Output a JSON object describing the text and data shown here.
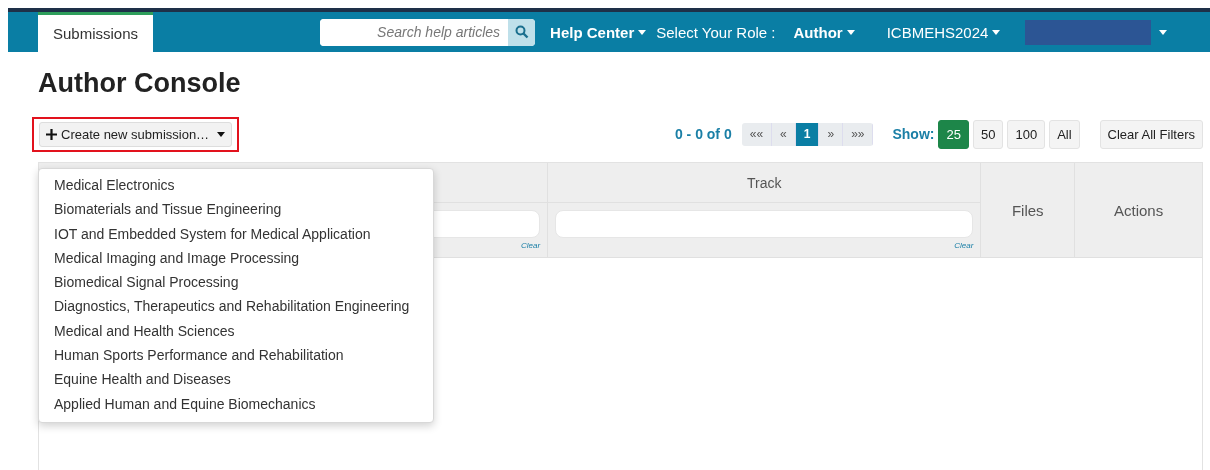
{
  "navbar": {
    "tabs": [
      {
        "label": "Submissions",
        "selected": true
      }
    ],
    "search": {
      "placeholder": "Search help articles"
    },
    "help_menu": "Help Center",
    "role_label": "Select Your Role :",
    "role": "Author",
    "conference": "ICBMEHS2024",
    "user_redacted": true
  },
  "title": "Author Console",
  "create_button": {
    "label": "Create new submission…",
    "expanded": true,
    "highlighted": true
  },
  "dropdown": [
    {
      "label": "Medical Electronics"
    },
    {
      "label": "Biomaterials and Tissue Engineering"
    },
    {
      "label": "IOT and Embedded System for Medical Application"
    },
    {
      "label": "Medical Imaging and Image Processing"
    },
    {
      "label": "Biomedical Signal Processing"
    },
    {
      "label": "Diagnostics, Therapeutics and Rehabilitation Engineering"
    },
    {
      "label": "Medical and Health Sciences"
    },
    {
      "label": "Human Sports Performance and Rehabilitation"
    },
    {
      "label": "Equine Health and Diseases"
    },
    {
      "label": "Applied Human and Equine Biomechanics"
    }
  ],
  "pagination": {
    "range": "0 - 0 of 0",
    "pages": [
      {
        "label": "««",
        "selected": false
      },
      {
        "label": "«",
        "selected": false
      },
      {
        "label": "1",
        "selected": true
      },
      {
        "label": "»",
        "selected": false
      },
      {
        "label": "»»",
        "selected": false
      }
    ]
  },
  "show": {
    "label": "Show:",
    "options": [
      {
        "label": "25",
        "selected": true
      },
      {
        "label": "50",
        "selected": false
      },
      {
        "label": "100",
        "selected": false
      },
      {
        "label": "All",
        "selected": false
      }
    ]
  },
  "clear_filters": "Clear All Filters",
  "table": {
    "columns": [
      {
        "filter": {
          "clear": "Clear"
        }
      },
      {
        "label": "Track",
        "filter": {
          "clear": "Clear"
        }
      },
      {
        "label": "Files"
      },
      {
        "label": "Actions"
      }
    ]
  }
}
